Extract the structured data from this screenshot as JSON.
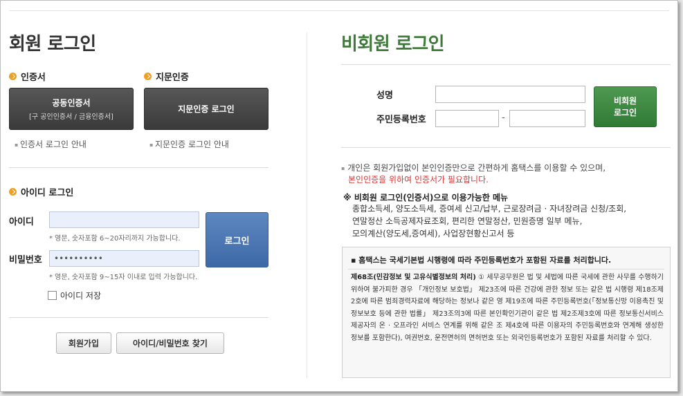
{
  "member": {
    "title": "회원 로그인",
    "cert_section": "인증서",
    "bio_section": "지문인증",
    "cert_button": {
      "line1": "공동인증서",
      "line2": "[구 공인인증서 / 금융인증서]"
    },
    "bio_button": "지문인증 로그인",
    "cert_guide": "인증서 로그인 안내",
    "bio_guide": "지문인증 로그인 안내",
    "id_section": "아이디 로그인",
    "id_label": "아이디",
    "id_value": "",
    "id_hint": "* 영문, 숫자포함 6~20자리까지 가능합니다.",
    "pw_label": "비밀번호",
    "pw_value": "••••••••••",
    "pw_hint": "* 영문, 숫자포함 9~15자 이내로 입력 가능합니다.",
    "login_button": "로그인",
    "save_id_label": "아이디 저장",
    "save_id_checked": false,
    "signup_button": "회원가입",
    "find_button": "아이디/비밀번호 찾기"
  },
  "guest": {
    "title": "비회원 로그인",
    "name_label": "성명",
    "rrn_label": "주민등록번호",
    "dash": "-",
    "login_line1": "비회원",
    "login_line2": "로그인",
    "note_line1": "개인은 회원가입없이 본인인증만으로 간편하게 홈택스를 이용할 수 있으며,",
    "note_line2": "본인인증을 위하여 인증서가 필요합니다.",
    "menu_title": "※ 비회원 로그인(인증서)으로 이용가능한 메뉴",
    "menu_lines": [
      "종합소득세, 양도소득세, 증여세 신고/납부, 근로장려금 · 자녀장려금 신청/조회,",
      "연말정산 소득공제자료조회, 편리한 연말정산, 민원증명 일부 메뉴,",
      "모의계산(양도세,증여세), 사업장현황신고서 등"
    ],
    "privacy_head": "▪ 홈택스는 국세기본법 시행령에 따라 주민등록번호가 포함된 자료를 처리합니다.",
    "privacy_law_title": "제68조(민감정보 및 고유식별정보의 처리)",
    "privacy_body": "① 세무공무원은 법 및 세법에 따른 국세에 관한 사무를 수행하기 위하여 불가피한 경우 「개인정보 보호법」 제23조에 따른 건강에 관한 정보 또는 같은 법 시행령 제18조제2호에 따른 범죄경력자료에 해당하는 정보나 같은 영 제19조에 따른 주민등록번호(「정보통신망 이용촉진 및 정보보호 등에 관한 법률」 제23조의3에 따른 본인확인기관이 같은 법 제2조제3호에 따른 정보통신서비스 제공자의 온 · 오프라인 서비스 연계를 위해 같은 조 제4호에 따른 이용자의 주민등록번호와 연계해 생성한 정보를 포함한다), 여권번호, 운전면허의 면허번호 또는 외국인등록번호가 포함된 자료를 처리할 수 있다."
  },
  "colors": {
    "accent_orange": "#f0a020",
    "green": "#3f7a3a",
    "blue_button": "#4a76b3",
    "dark_button": "#454545",
    "red_text": "#dd3333"
  }
}
